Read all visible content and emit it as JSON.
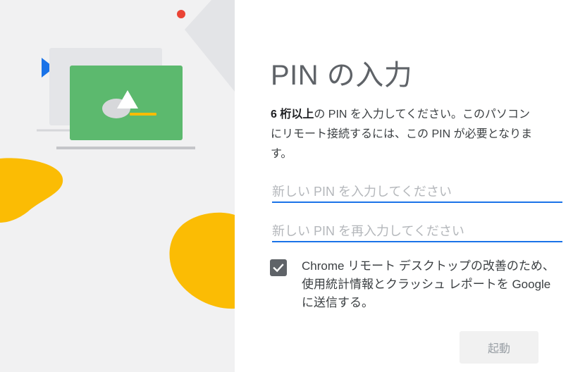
{
  "illustration": {
    "colors": {
      "panel": "#f1f1f2",
      "card": "#5cb96e",
      "accent_yellow": "#fbbc04",
      "accent_red": "#ea4335",
      "accent_blue": "#1a73e8",
      "device_gray": "#e4e5e8",
      "base_gray": "#c4c5c9"
    }
  },
  "dialog": {
    "title": "PIN の入力",
    "description_bold": "6 桁以上",
    "description_rest": "の PIN を入力してください。このパソコンにリモート接続するには、この PIN が必要となります。",
    "pin_input": {
      "placeholder": "新しい PIN を入力してください",
      "value": ""
    },
    "pin_confirm_input": {
      "placeholder": "新しい PIN を再入力してください",
      "value": ""
    },
    "consent": {
      "checked": true,
      "label": "Chrome リモート デスクトップの改善のため、使用統計情報とクラッシュ レポートを Google に送信する。"
    },
    "start_button_label": "起動",
    "colors": {
      "title": "#5f6368",
      "text": "#3c4043",
      "input_underline": "#1a73e8",
      "placeholder": "#b4b7bb",
      "checkbox": "#5f6368",
      "button_bg": "#f1f1f1",
      "button_text": "#9aa0a6"
    }
  }
}
